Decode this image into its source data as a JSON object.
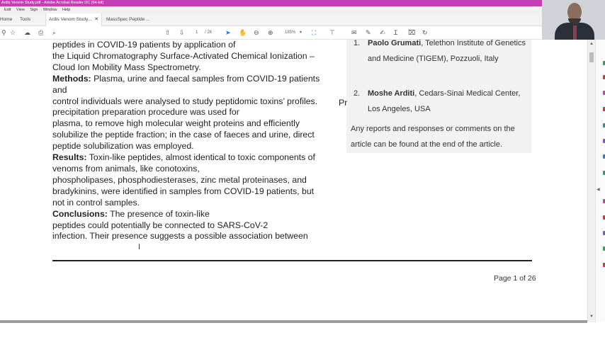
{
  "window": {
    "title": "Ardis Venom Study.pdf - Adobe Acrobat Reader DC (64-bit)"
  },
  "menu": [
    "Edit",
    "View",
    "Sign",
    "Window",
    "Help"
  ],
  "tabs": {
    "home": "Home",
    "tools": "Tools",
    "documents": [
      {
        "label": "Ardis Venom Study...",
        "active": true
      },
      {
        "label": "MassSpec Peptide ...",
        "active": false
      }
    ]
  },
  "toolbar": {
    "page_current": "1",
    "page_total": "/ 26",
    "zoom": "185%"
  },
  "document": {
    "lines": [
      {
        "bold": "",
        "text": "peptides in COVID-19 patients by application of"
      },
      {
        "bold": "",
        "text": "the Liquid Chromatography Surface-Activated Chemical Ionization –"
      },
      {
        "bold": "",
        "text": "Cloud Ion Mobility Mass Spectrometry."
      },
      {
        "bold": "Methods:",
        "text": " Plasma, urine and faecal samples from COVID-19 patients"
      },
      {
        "bold": "",
        "text": "and"
      },
      {
        "bold": "",
        "text": "control individuals were analysed to study peptidomic toxins’ profiles."
      },
      {
        "bold": "",
        "text": "precipitation preparation procedure was used for"
      },
      {
        "bold": "",
        "text": "plasma, to remove high molecular weight proteins and efficiently"
      },
      {
        "bold": "",
        "text": "solubilize the peptide fraction; in the case of faeces and urine, direct"
      },
      {
        "bold": "",
        "text": "peptide solubilization was employed."
      },
      {
        "bold": "Results:",
        "text": " Toxin-like peptides, almost identical to toxic components of"
      },
      {
        "bold": "",
        "text": "venoms from animals, like conotoxins,"
      },
      {
        "bold": "",
        "text": "phospholipases, phosphodiesterases, zinc metal proteinases, and"
      },
      {
        "bold": "",
        "text": "bradykinins, were identified in samples from COVID-19 patients, but"
      },
      {
        "bold": "",
        "text": "not in control samples."
      },
      {
        "bold": "Conclusions:",
        "text": " The presence of toxin-like"
      },
      {
        "bold": "",
        "text": "peptides could potentially be connected to SARS-CoV-2"
      },
      {
        "bold": "",
        "text": "infection. Their presence suggests a possible association between"
      }
    ],
    "overflow_fragment": "Pr",
    "affiliations": [
      {
        "num": "1.",
        "name": "Paolo Grumati",
        "detail": ", Telethon Institute of Genetics and Medicine (TIGEM), Pozzuoli, Italy"
      },
      {
        "num": "2.",
        "name": "Moshe Arditi",
        "detail": ", Cedars-Sinai Medical Center, Los Angeles, USA"
      }
    ],
    "note": "Any reports and responses or comments on the article can be found at the end of the article.",
    "page_label": "Page 1 of 26"
  },
  "colors": {
    "titlebar": "#c43fb6",
    "accent": "#1473e6",
    "affiliation_bg": "#f2f2f2"
  }
}
